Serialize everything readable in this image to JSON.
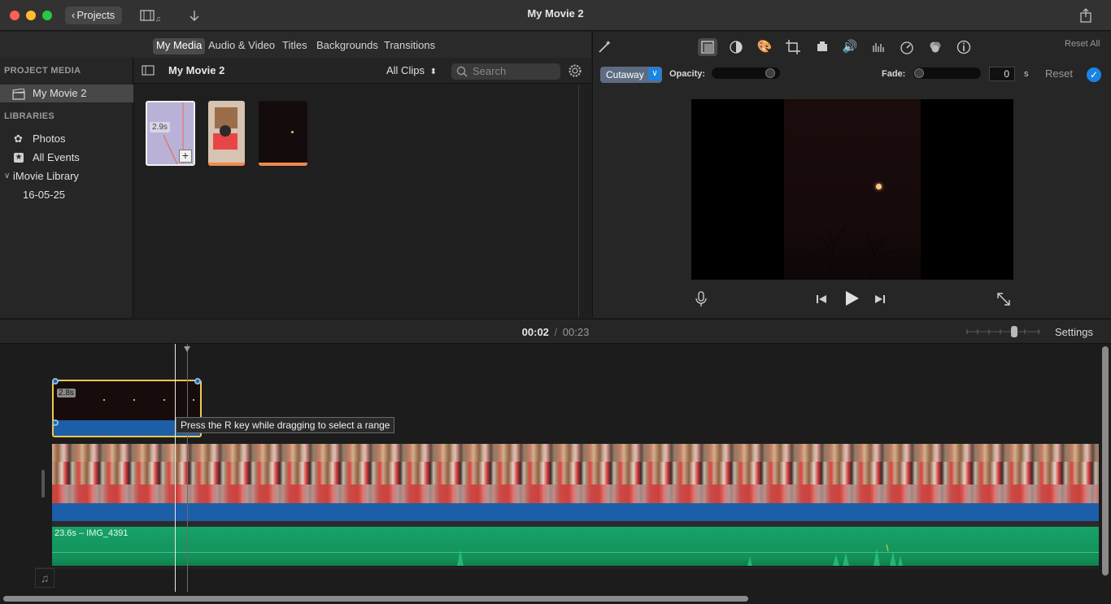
{
  "window": {
    "title": "My Movie 2",
    "projects_label": "Projects"
  },
  "media_tabs": [
    "My Media",
    "Audio & Video",
    "Titles",
    "Backgrounds",
    "Transitions"
  ],
  "sidebar": {
    "project_media_header": "PROJECT MEDIA",
    "project_item": "My Movie 2",
    "libraries_header": "LIBRARIES",
    "library_items": [
      "Photos",
      "All Events",
      "iMovie Library",
      "16-05-25"
    ]
  },
  "browser": {
    "title": "My Movie 2",
    "filter": "All Clips",
    "search_placeholder": "Search",
    "clips": [
      {
        "duration": "2.9s"
      },
      {
        "duration": ""
      },
      {
        "duration": ""
      }
    ]
  },
  "viewer": {
    "reset_all": "Reset All",
    "overlay_mode": "Cutaway",
    "opacity_label": "Opacity:",
    "fade_label": "Fade:",
    "fade_value": "0",
    "fade_unit": "s",
    "reset": "Reset"
  },
  "timeline": {
    "current_time": "00:02",
    "separator": "/",
    "total_time": "00:23",
    "settings": "Settings",
    "cutaway_clip_duration": "2.8s",
    "main_clip_label": "23.6s – IMG_4391",
    "tooltip": "Press the R key while dragging to select a range"
  },
  "icons": {
    "tools": [
      "magic-wand-icon",
      "crop-frame-icon",
      "color-balance-icon",
      "color-palette-icon",
      "crop-icon",
      "stabilize-icon",
      "volume-icon",
      "equalizer-icon",
      "speed-icon",
      "filter-icon",
      "info-icon"
    ]
  },
  "colors": {
    "accent": "#1a84e4",
    "selection_yellow": "#f2c94c",
    "audio_green": "#17a36a",
    "video_blue": "#1d5ea8"
  }
}
